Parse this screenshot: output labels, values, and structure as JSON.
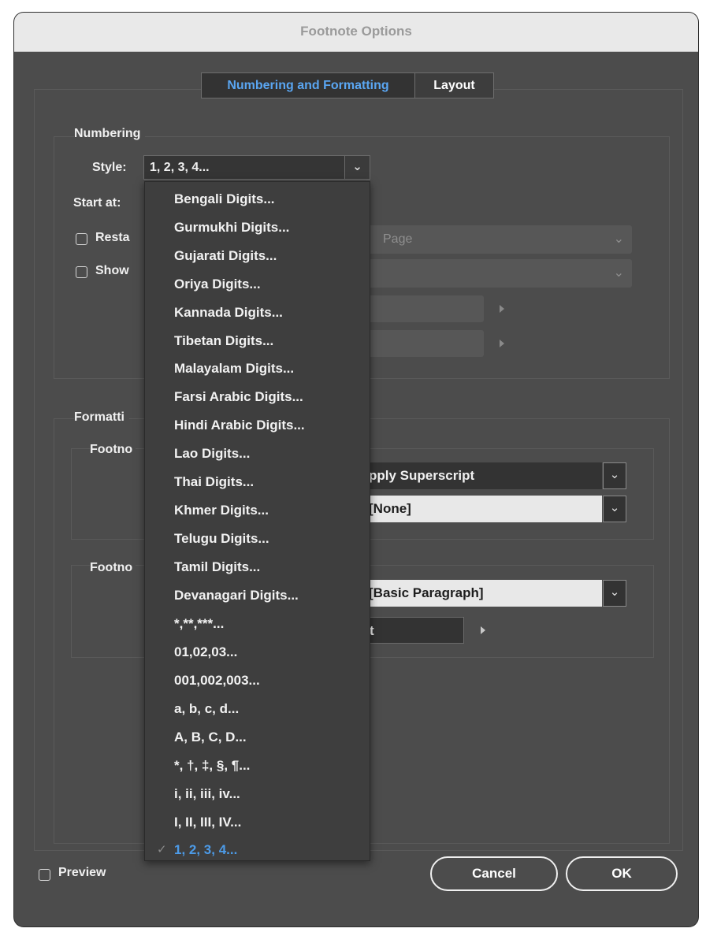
{
  "window": {
    "title": "Footnote Options"
  },
  "tabs": [
    {
      "label": "Numbering and Formatting",
      "active": true
    },
    {
      "label": "Layout",
      "active": false
    }
  ],
  "numbering": {
    "section_label": "Numbering",
    "style_label": "Style:",
    "style_value": "1, 2, 3, 4...",
    "start_at_label": "Start at:",
    "restart_label": "Resta",
    "restart_value": "Page",
    "show_label": "Show"
  },
  "formatting": {
    "section_label": "Formatti",
    "footnote_ref_label": "Footno",
    "position_value": "pply Superscript",
    "char_style_value": "[None]",
    "footnote_format_label": "Footno",
    "para_style_value": "[Basic Paragraph]",
    "separator_value": "t"
  },
  "style_menu": {
    "items": [
      "Bengali Digits...",
      "Gurmukhi Digits...",
      "Gujarati Digits...",
      "Oriya Digits...",
      "Kannada Digits...",
      "Tibetan Digits...",
      "Malayalam Digits...",
      "Farsi Arabic Digits...",
      "Hindi Arabic Digits...",
      "Lao Digits...",
      "Thai Digits...",
      "Khmer Digits...",
      "Telugu Digits...",
      "Tamil Digits...",
      "Devanagari Digits...",
      "*,**,***...",
      "01,02,03...",
      "001,002,003...",
      "a, b, c, d...",
      "A, B, C, D...",
      "*, †, ‡, §, ¶...",
      "i, ii, iii, iv...",
      "I, II, III, IV...",
      "1, 2, 3, 4..."
    ],
    "selected_index": 23,
    "check_glyph": "✓"
  },
  "footer": {
    "preview_label": "Preview",
    "cancel_label": "Cancel",
    "ok_label": "OK"
  }
}
